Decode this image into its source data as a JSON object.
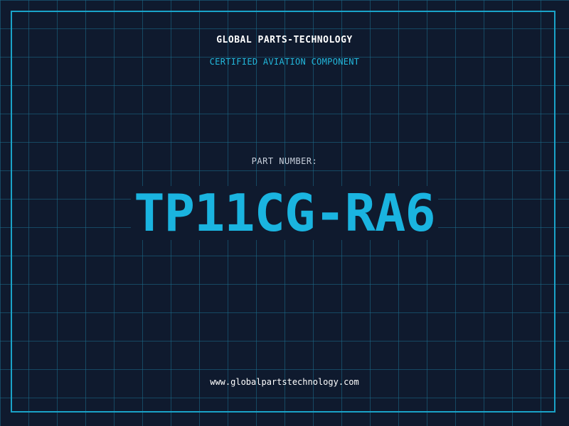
{
  "header": {
    "company": "GLOBAL PARTS-TECHNOLOGY",
    "subtitle": "CERTIFIED AVIATION COMPONENT"
  },
  "part": {
    "label": "PART NUMBER:",
    "number": "TP11CG-RA6"
  },
  "footer": {
    "website": "www.globalpartstechnology.com"
  },
  "colors": {
    "background": "#0f1a2e",
    "grid": "#1c6e8c",
    "accent": "#1aa3c8",
    "part_number": "#1ab4e0",
    "text": "#ffffff"
  }
}
